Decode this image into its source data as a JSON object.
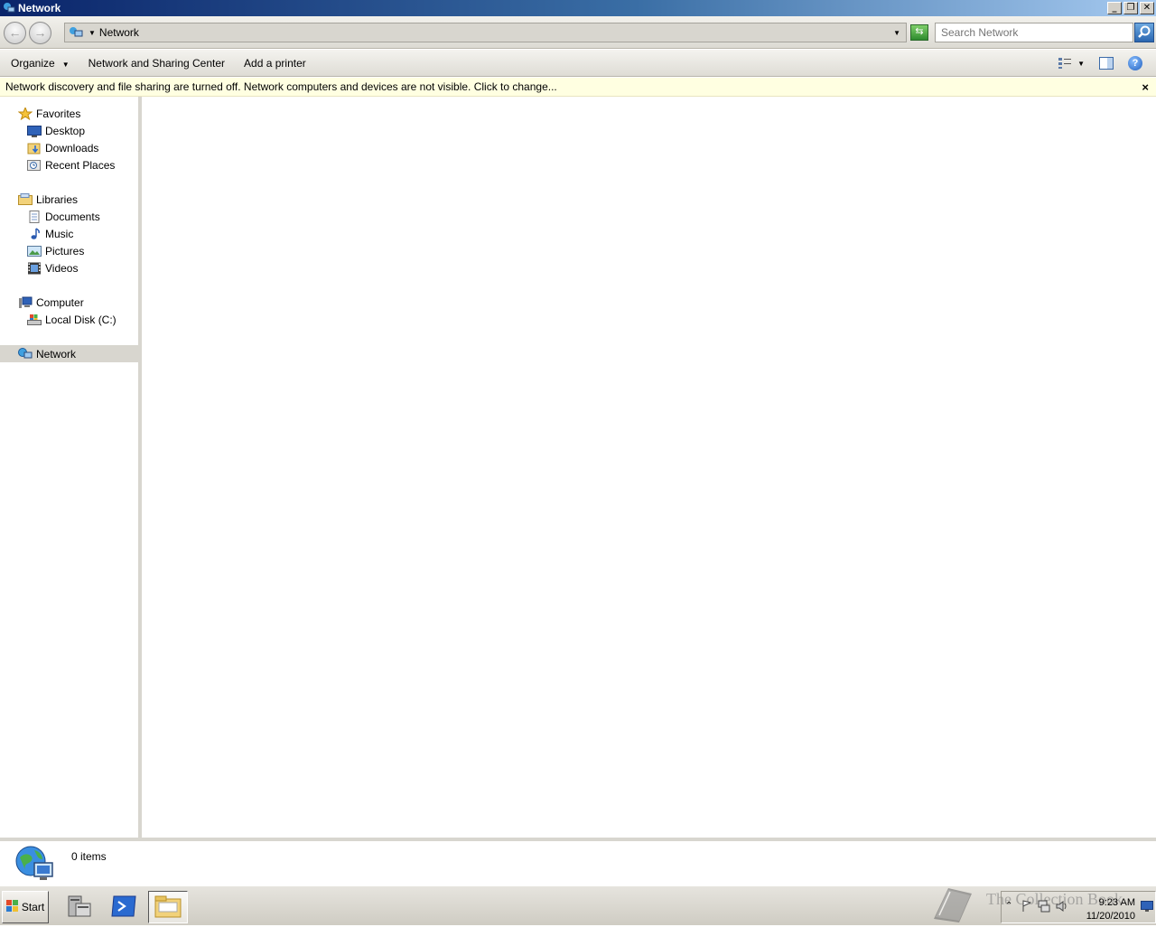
{
  "window": {
    "title": "Network"
  },
  "address_bar": {
    "breadcrumb": "Network",
    "search_placeholder": "Search Network"
  },
  "toolbar": {
    "organize_label": "Organize",
    "network_sharing_label": "Network and Sharing Center",
    "add_printer_label": "Add a printer"
  },
  "infobar": {
    "message": "Network discovery and file sharing are turned off. Network computers and devices are not visible. Click to change...",
    "close_glyph": "×"
  },
  "nav": {
    "favorites": {
      "label": "Favorites",
      "items": [
        {
          "label": "Desktop"
        },
        {
          "label": "Downloads"
        },
        {
          "label": "Recent Places"
        }
      ]
    },
    "libraries": {
      "label": "Libraries",
      "items": [
        {
          "label": "Documents"
        },
        {
          "label": "Music"
        },
        {
          "label": "Pictures"
        },
        {
          "label": "Videos"
        }
      ]
    },
    "computer": {
      "label": "Computer",
      "items": [
        {
          "label": "Local Disk (C:)"
        }
      ]
    },
    "network": {
      "label": "Network"
    }
  },
  "details": {
    "item_count": "0 items"
  },
  "taskbar": {
    "start_label": "Start",
    "watermark": "The Collection Book"
  },
  "clock": {
    "time": "9:23 AM",
    "date": "11/20/2010"
  },
  "colors": {
    "title_gradient_start": "#0a246a",
    "infobar_bg": "#ffffe1",
    "selected_bg": "#d8d6cf"
  }
}
